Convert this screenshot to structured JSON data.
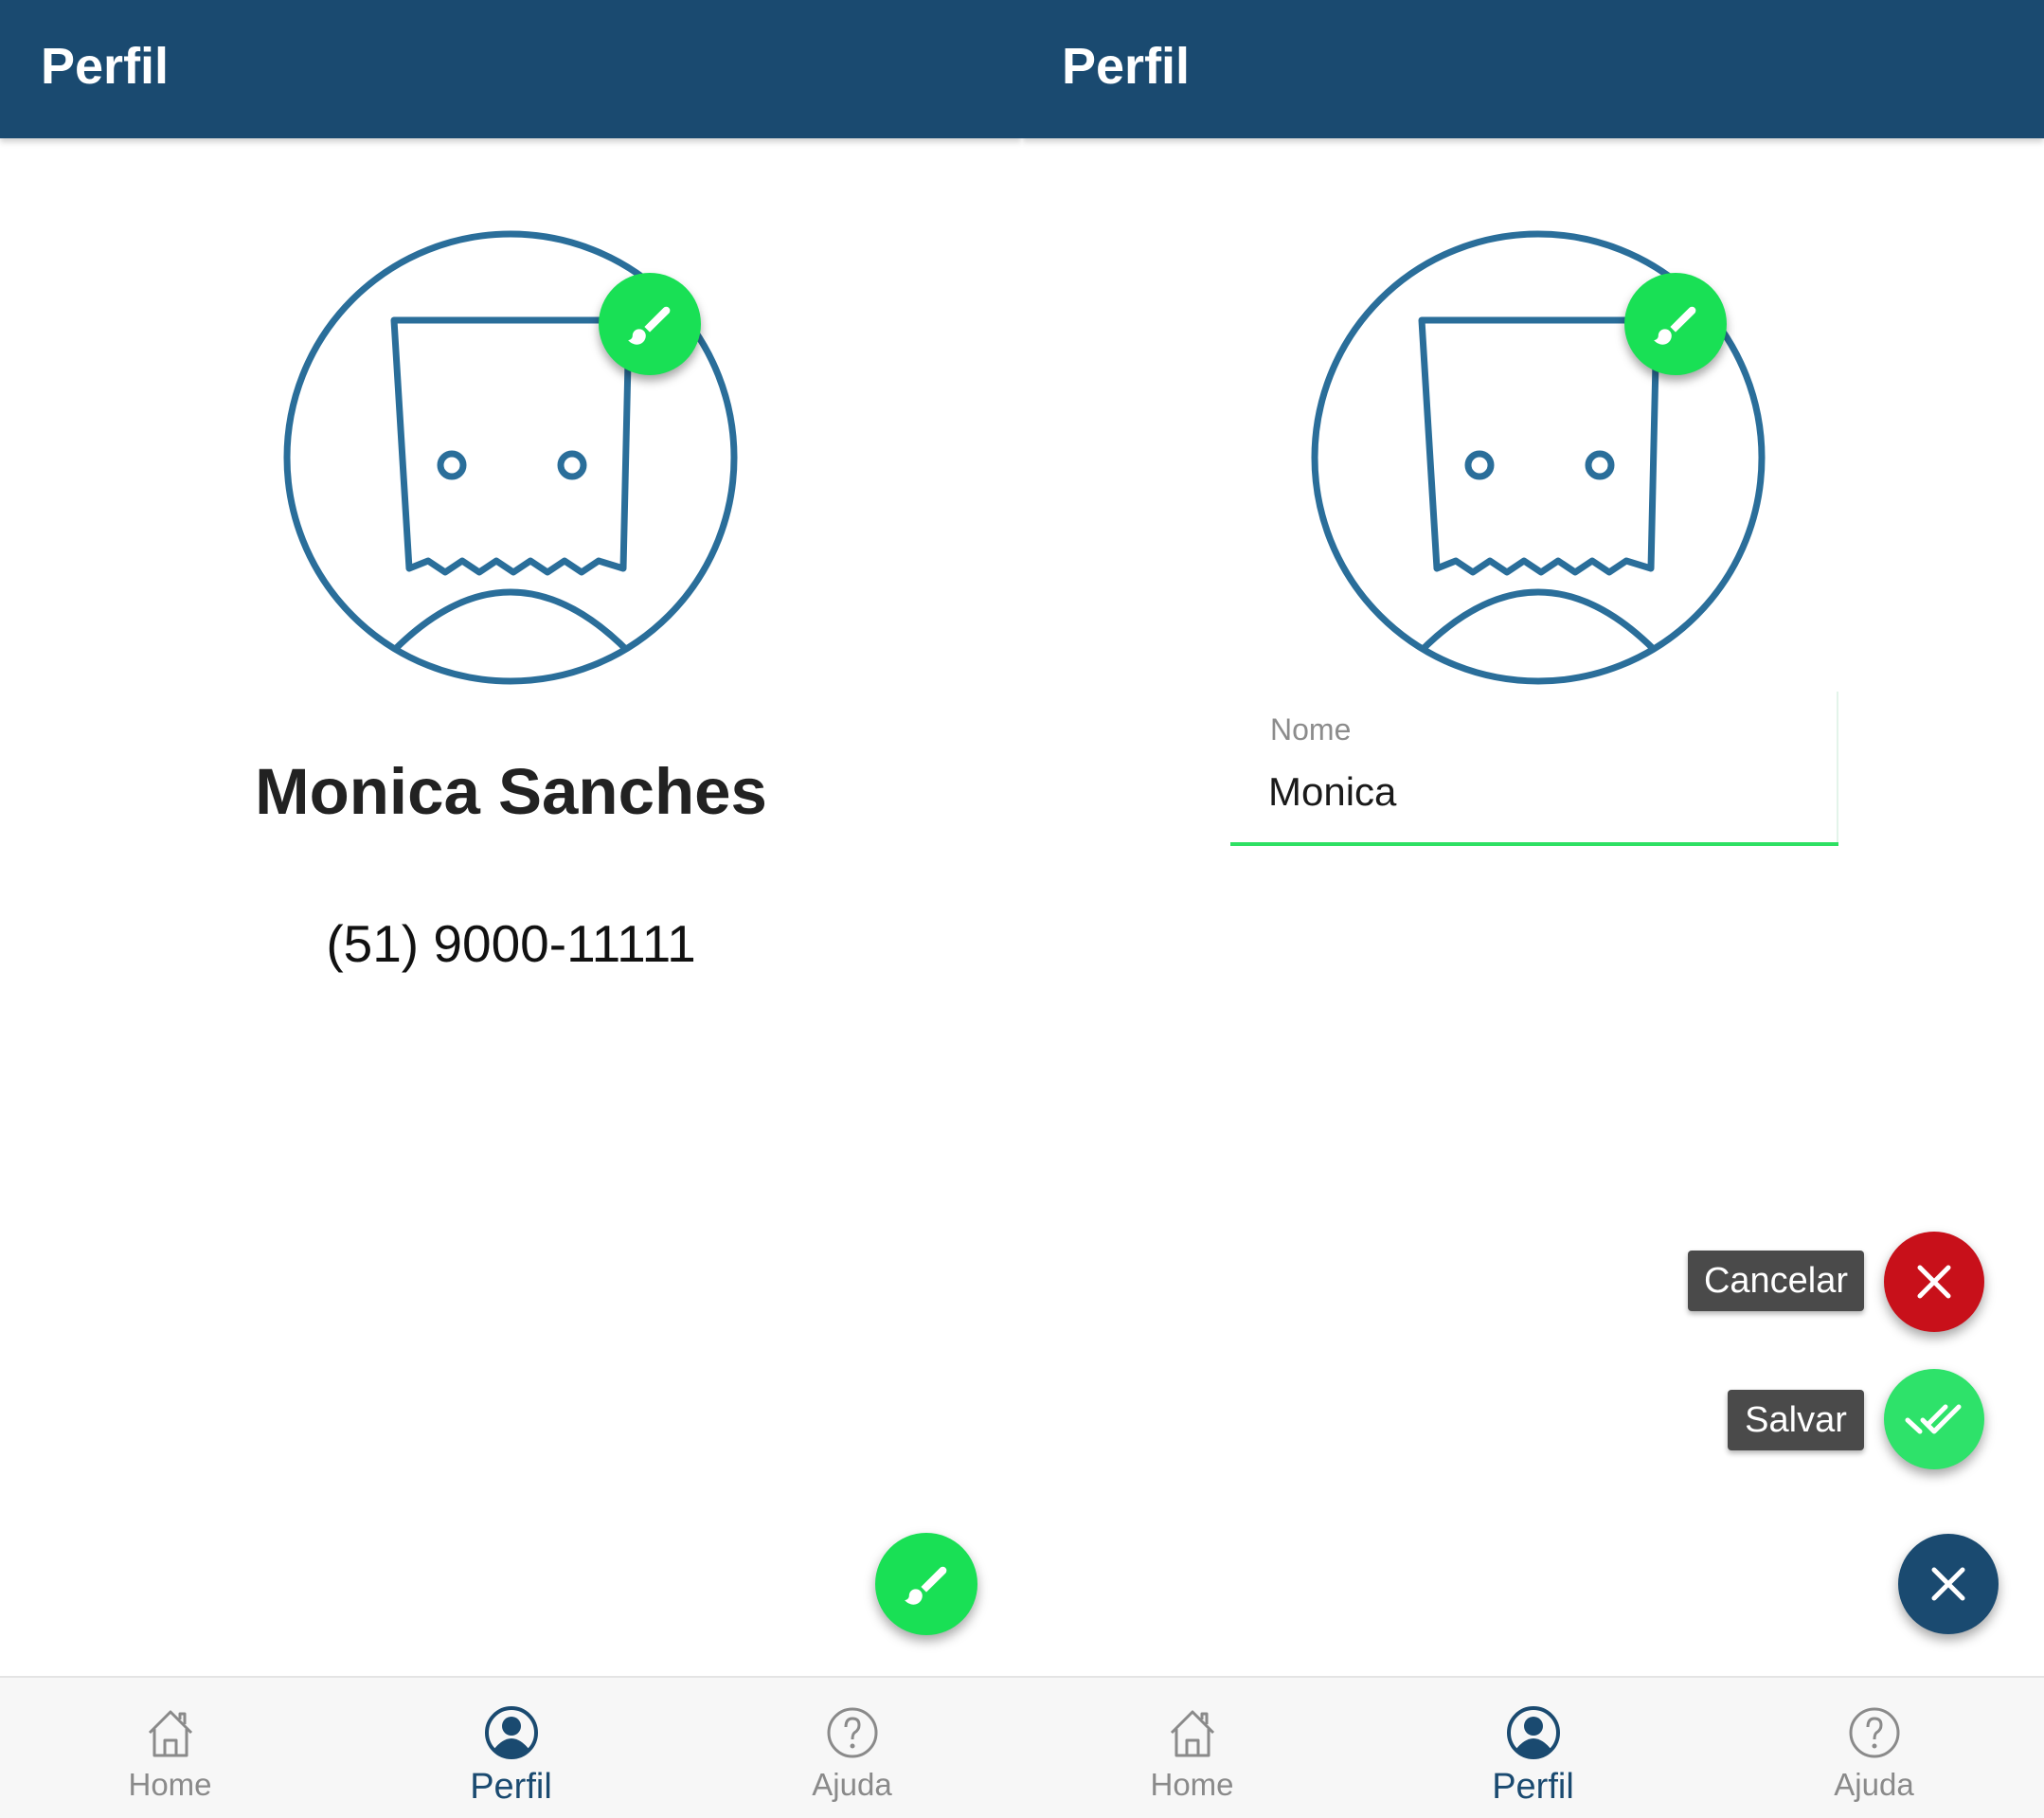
{
  "colors": {
    "header_bg": "#1a4a70",
    "accent_green": "#19e055",
    "cancel_red": "#c8101a",
    "avatar_stroke": "#2a6e9a",
    "nav_active": "#1a4a70",
    "nav_inactive": "#8a8a8a"
  },
  "screen_view": {
    "header": {
      "title": "Perfil"
    },
    "avatar": {
      "icon": "paper-bag-face-avatar",
      "edit_icon": "brush-icon"
    },
    "profile": {
      "name": "Monica Sanches",
      "phone": "(51) 9000-11111"
    },
    "fab": {
      "icon": "brush-icon"
    },
    "nav": [
      {
        "label": "Home",
        "icon": "home-icon",
        "active": false
      },
      {
        "label": "Perfil",
        "icon": "profile-icon",
        "active": true
      },
      {
        "label": "Ajuda",
        "icon": "help-icon",
        "active": false
      }
    ]
  },
  "screen_edit": {
    "header": {
      "title": "Perfil"
    },
    "avatar": {
      "icon": "paper-bag-face-avatar",
      "edit_icon": "brush-icon"
    },
    "form": {
      "name_label": "Nome",
      "name_value": "Monica"
    },
    "actions": {
      "cancel_label": "Cancelar",
      "save_label": "Salvar",
      "cancel_icon": "close-icon",
      "save_icon": "double-check-icon",
      "close_icon": "close-icon"
    },
    "nav": [
      {
        "label": "Home",
        "icon": "home-icon",
        "active": false
      },
      {
        "label": "Perfil",
        "icon": "profile-icon",
        "active": true
      },
      {
        "label": "Ajuda",
        "icon": "help-icon",
        "active": false
      }
    ]
  }
}
